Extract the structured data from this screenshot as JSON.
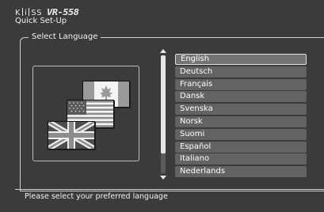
{
  "header": {
    "brand_letters": [
      "K",
      "i",
      "S",
      "S"
    ],
    "model": "VR-558",
    "title": "Quick Set-Up"
  },
  "section": {
    "legend": "Select Language"
  },
  "flags": [
    "flag-canada",
    "flag-usa",
    "flag-uk"
  ],
  "languages": [
    {
      "label": "English",
      "selected": true
    },
    {
      "label": "Deutsch",
      "selected": false
    },
    {
      "label": "Français",
      "selected": false
    },
    {
      "label": "Dansk",
      "selected": false
    },
    {
      "label": "Svenska",
      "selected": false
    },
    {
      "label": "Norsk",
      "selected": false
    },
    {
      "label": "Suomi",
      "selected": false
    },
    {
      "label": "Español",
      "selected": false
    },
    {
      "label": "Italiano",
      "selected": false
    },
    {
      "label": "Nederlands",
      "selected": false
    }
  ],
  "scrollbar": {
    "visible_fraction": 0.83
  },
  "status": {
    "message": "Please select your preferred language"
  },
  "colors": {
    "background": "#3b3b3b",
    "list_item": "#636363",
    "selected_border": "#e0e0e0"
  }
}
